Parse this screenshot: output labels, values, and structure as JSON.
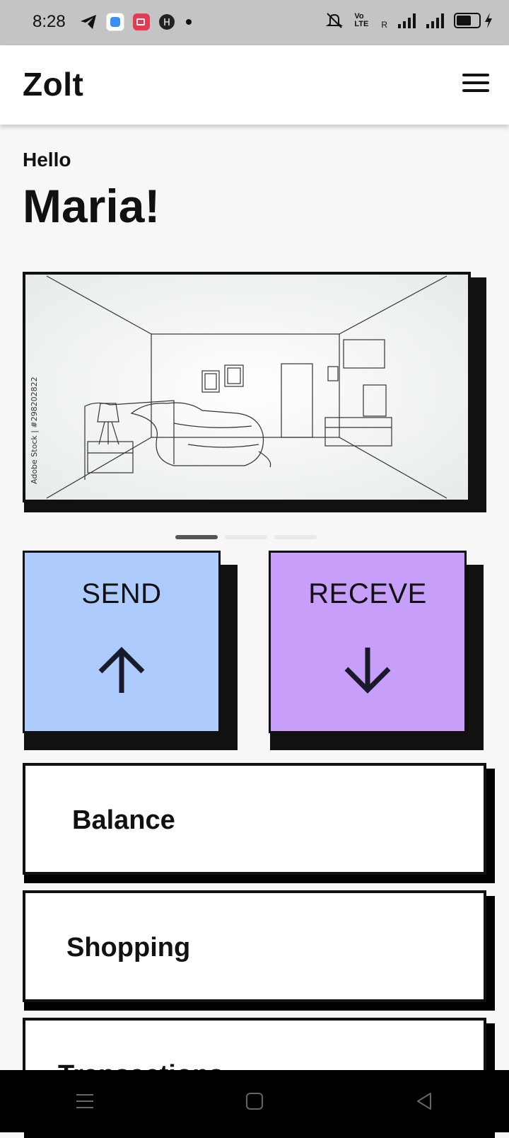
{
  "status_bar": {
    "time": "8:28",
    "icons_left": [
      "telegram-icon",
      "app-icon-blue",
      "screen-record-icon",
      "app-icon-dark",
      "notification-dot-icon"
    ],
    "icons_right": [
      "mute-icon",
      "volte-icon",
      "signal-icon",
      "signal-icon",
      "battery-charging-icon"
    ],
    "network_label": "Vo LTE",
    "roaming": "R"
  },
  "header": {
    "brand": "Zolt",
    "menu_icon": "hamburger-icon"
  },
  "greeting": {
    "small": "Hello",
    "name": "Maria!"
  },
  "carousel": {
    "slide_count": 3,
    "active_index": 0,
    "image_caption": "Adobe Stock | #298202822"
  },
  "actions": [
    {
      "label": "SEND",
      "icon": "arrow-up-icon",
      "color": "#aecbfe"
    },
    {
      "label": "RECEVE",
      "icon": "arrow-down-icon",
      "color": "#c89efb"
    }
  ],
  "list": [
    {
      "label": "Balance"
    },
    {
      "label": "Shopping"
    },
    {
      "label": "Transactions"
    }
  ],
  "nav": [
    "menu-icon",
    "home-icon",
    "back-icon"
  ]
}
